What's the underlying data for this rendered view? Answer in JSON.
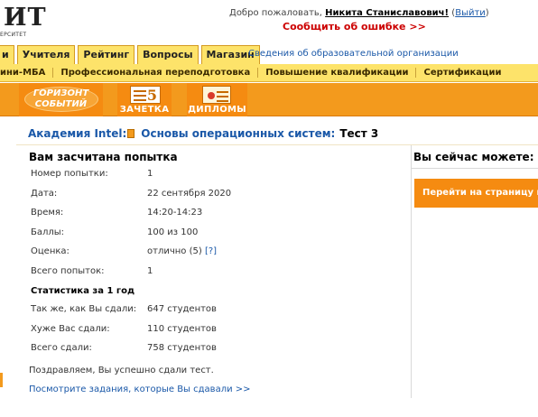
{
  "logo": {
    "main": "ИТ",
    "sub": "ЕРСИТЕТ"
  },
  "header": {
    "welcome": "Добро пожаловать, ",
    "user_name": "Никита Станиславович!",
    "exit_open": " (",
    "exit_label": "Выйти",
    "exit_close": ")",
    "report_error": "Сообщить об ошибке >>"
  },
  "tabs": [
    {
      "label": "и"
    },
    {
      "label": "Учителя"
    },
    {
      "label": "Рейтинг"
    },
    {
      "label": "Вопросы"
    },
    {
      "label": "Магазин"
    }
  ],
  "edu_info": "Сведения об образовательной организации",
  "subnav": [
    {
      "label": "ини-МБА"
    },
    {
      "label": "Профессиональная переподготовка"
    },
    {
      "label": "Повышение квалификации"
    },
    {
      "label": "Сертификации"
    }
  ],
  "banners": {
    "horizon_line1": "ГОРИЗОНТ",
    "horizon_line2": "СОБЫТИЙ",
    "zachetka_number": "5",
    "zachetka_label": "ЗАЧЕТКА",
    "diplomas_label": "ДИПЛОМЫ"
  },
  "breadcrumb": {
    "org": "Академия Intel:",
    "course": "Основы операционных систем:",
    "test": "Тест 3"
  },
  "result": {
    "title": "Вам засчитана попытка",
    "rows": [
      {
        "label": "Номер попытки:",
        "value": "1"
      },
      {
        "label": "Дата:",
        "value": "22 сентября 2020"
      },
      {
        "label": "Время:",
        "value": "14:20-14:23"
      },
      {
        "label": "Баллы:",
        "value": "100 из 100"
      },
      {
        "label": "Оценка:",
        "value": "отлично (5)",
        "help": "[?]"
      },
      {
        "label": "Всего попыток:",
        "value": "1"
      }
    ],
    "stats_title": "Статистика за 1 год",
    "stats": [
      {
        "label": "Так же, как Вы сдали:",
        "value": "647 студентов"
      },
      {
        "label": "Хуже Вас сдали:",
        "value": "110 студентов"
      },
      {
        "label": "Всего сдали:",
        "value": "758 студентов"
      }
    ],
    "congrats": "Поздравляем, Вы успешно сдали тест.",
    "view_tasks": "Посмотрите задания, которые Вы сдавали >>"
  },
  "sidebar": {
    "title": "Вы сейчас можете:",
    "button": "Перейти на страницу курса"
  }
}
